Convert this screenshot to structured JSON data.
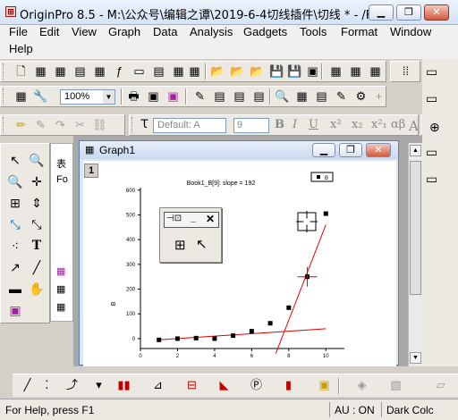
{
  "window": {
    "title": "OriginPro 8.5 - M:\\公众号\\编辑之谭\\2019-6-4切线插件\\切线 * - /F...",
    "minimize": "▁",
    "restore": "❐",
    "close": "✕"
  },
  "menu": [
    "File",
    "Edit",
    "View",
    "Graph",
    "Data",
    "Analysis",
    "Gadgets",
    "Tools",
    "Format",
    "Window",
    "Help"
  ],
  "toolbar": {
    "zoom": "100%",
    "font": "Default: A",
    "size": "9",
    "bold": "B",
    "italic": "I",
    "underline": "U",
    "superscript": "x²",
    "subscript": "x₂",
    "supsub": "x²₁",
    "greek": "αβ",
    "increase_font": "A",
    "decrease_font": "A"
  },
  "side_labels": {
    "s1": "表",
    "s2": "Fo"
  },
  "graph": {
    "window_title": "Graph1",
    "layer": "1",
    "slope_label": "Book1_B[9]: slope = 192",
    "legend_label": "B"
  },
  "chart_data": {
    "type": "scatter",
    "title": "",
    "xlabel": "",
    "ylabel": "B",
    "xlim": [
      0,
      11
    ],
    "ylim": [
      -40,
      610
    ],
    "x_ticks": [
      0,
      2,
      4,
      6,
      8,
      10
    ],
    "y_ticks": [
      0,
      100,
      200,
      300,
      400,
      500,
      600
    ],
    "series": [
      {
        "name": "B",
        "x": [
          1,
          2,
          3,
          4,
          5,
          6,
          7,
          8,
          9,
          10
        ],
        "y": [
          -5,
          0,
          2,
          0,
          12,
          30,
          62,
          125,
          250,
          505
        ]
      }
    ],
    "fit_line": {
      "x": [
        1,
        10
      ],
      "y": [
        -5,
        40
      ]
    },
    "tangent_line": {
      "x": [
        7.3,
        10
      ],
      "y": [
        -60,
        460
      ]
    },
    "tangent_point": {
      "x": 9,
      "y": 250
    }
  },
  "status": {
    "help": "For Help, press F1",
    "au": "AU : ON",
    "theme": "Dark Colc"
  }
}
